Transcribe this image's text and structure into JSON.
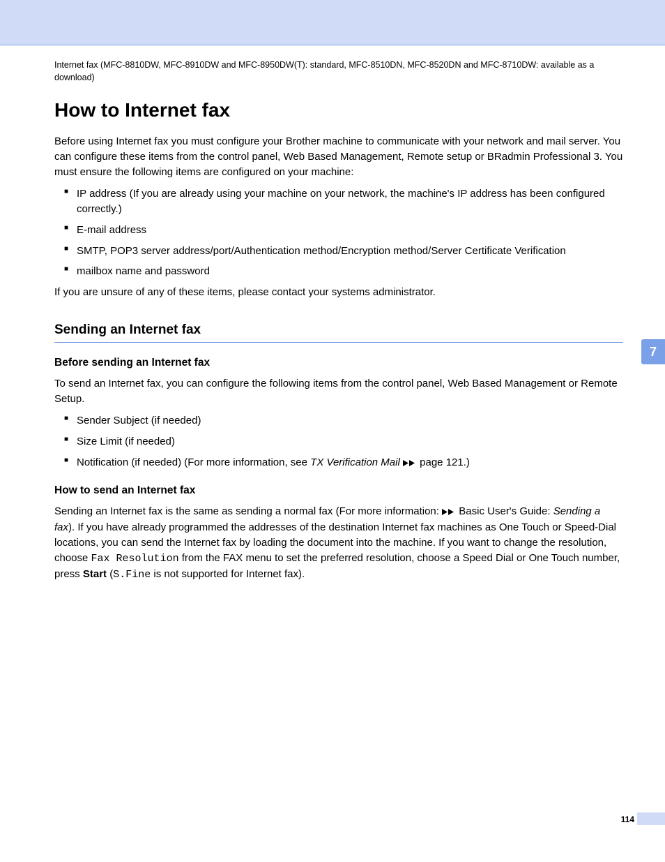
{
  "header_note": "Internet fax (MFC-8810DW, MFC-8910DW and MFC-8950DW(T): standard, MFC-8510DN, MFC-8520DN and MFC-8710DW: available as a download)",
  "h1": "How to Internet fax",
  "intro": "Before using Internet fax you must configure your Brother machine to communicate with your network and mail server. You can configure these items from the control panel, Web Based Management, Remote setup or BRadmin Professional 3. You must ensure the following items are configured on your machine:",
  "config_items": [
    "IP address (If you are already using your machine on your network, the machine's IP address has been configured correctly.)",
    "E-mail address",
    "SMTP, POP3 server address/port/Authentication method/Encryption method/Server Certificate Verification",
    "mailbox name and password"
  ],
  "unsure": "If you are unsure of any of these items, please contact your systems administrator.",
  "h2": "Sending an Internet fax",
  "h3a": "Before sending an Internet fax",
  "before_para": "To send an Internet fax, you can configure the following items from the control panel, Web Based Management or Remote Setup.",
  "before_items": {
    "i0": "Sender Subject (if needed)",
    "i1": "Size Limit (if needed)",
    "i2a": "Notification (if needed) (For more information, see ",
    "i2b": "TX Verification Mail",
    "i2c": " page 121.)"
  },
  "h3b": "How to send an Internet fax",
  "send": {
    "p1a": "Sending an Internet fax is the same as sending a normal fax (For more information: ",
    "p1b": " Basic User's Guide: ",
    "p1c": "Sending a fax",
    "p1d": "). If you have already programmed the addresses of the destination Internet fax machines as One Touch or Speed-Dial locations, you can send the Internet fax by loading the document into the machine. If you want to change the resolution, choose ",
    "p1e": "Fax Resolution",
    "p1f": " from the FAX menu to set the preferred resolution, choose a Speed Dial or One Touch number, press ",
    "p1g": "Start",
    "p1h": " (",
    "p1i": "S.Fine",
    "p1j": " is not supported for Internet fax)."
  },
  "chapter": "7",
  "page": "114"
}
